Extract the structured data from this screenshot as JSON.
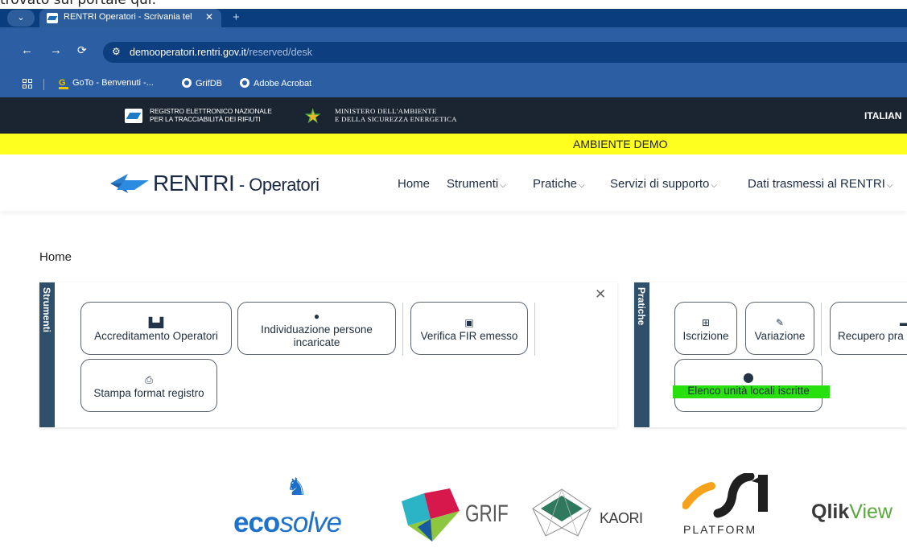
{
  "caption": "trovato sul portale qui:",
  "browser": {
    "tab_title": "RENTRI Operatori - Scrivania tel",
    "tab_close": "✕",
    "new_tab": "+",
    "url_host": "demooperatori.rentri.gov.it",
    "url_path": "/reserved/desk",
    "bookmarks": [
      "GoTo - Benvenuti -...",
      "GrifDB",
      "Adobe Acrobat"
    ]
  },
  "gov_bar": {
    "rentri_line1": "REGISTRO ELETTRONICO NAZIONALE",
    "rentri_line2": "PER LA TRACCIABILITÀ DEI RIFIUTI",
    "ministry_line1": "MINISTERO DELL'AMBIENTE",
    "ministry_line2": "E DELLA SICUREZZA ENERGETICA",
    "language": "ITALIAN"
  },
  "env_banner": "AMBIENTE DEMO",
  "header": {
    "logo_main": "RENTRI",
    "logo_sub": " - Operatori",
    "nav": [
      "Home",
      "Strumenti",
      "Pratiche",
      "Servizi di supporto",
      "Dati trasmessi al RENTRI"
    ]
  },
  "breadcrumb": "Home",
  "strumenti": {
    "title": "Strumenti",
    "close": "✕",
    "buttons": [
      {
        "label": "Accreditamento Operatori",
        "icon": "factory-icon"
      },
      {
        "label": "Individuazione persone incaricate",
        "icon": "person-icon"
      },
      {
        "label": "Verifica FIR emesso",
        "icon": "clipboard-check-icon"
      },
      {
        "label": "Stampa format registro",
        "icon": "printer-icon"
      }
    ]
  },
  "pratiche": {
    "title": "Pratiche",
    "buttons": [
      {
        "label": "Iscrizione",
        "icon": "plus-square-icon"
      },
      {
        "label": "Variazione",
        "icon": "edit-icon"
      },
      {
        "label": "Recupero pra",
        "icon": "folder-icon"
      },
      {
        "label": "Elenco unità locali iscritte",
        "icon": "map-pin-icon"
      }
    ]
  },
  "sponsors": {
    "ecosolve_bold": "eco",
    "ecosolve_rest": "solve",
    "grif": "GRIF",
    "kaori": "KAORI",
    "platform": "PLATFORM",
    "qlik_bold": "Qlik",
    "qlik_rest": "View"
  },
  "colors": {
    "tab_strip": "#0a3d7e",
    "address_bar": "#2c5ea3",
    "gov_bar": "#1b2431",
    "demo_banner": "#ffff1e",
    "panel_side": "#304f6a",
    "highlight": "#28e00d"
  }
}
